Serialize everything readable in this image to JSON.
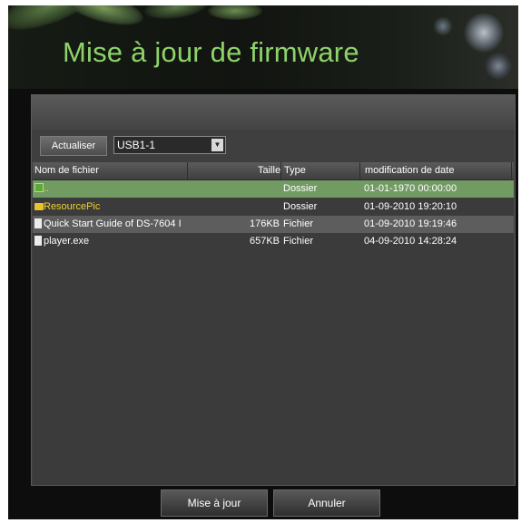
{
  "dialog": {
    "title": "Mise à jour de firmware"
  },
  "toolbar": {
    "refresh_label": "Actualiser",
    "device_select_value": "USB1-1"
  },
  "file_list": {
    "columns": {
      "name": "Nom de fichier",
      "size": "Taille",
      "type": "Type",
      "date": "modification de date"
    },
    "rows": [
      {
        "name": "..",
        "size": "",
        "type": "Dossier",
        "date": "01-01-1970 00:00:00",
        "icon": "parent-folder-icon",
        "selected": true
      },
      {
        "name": "ResourcePic",
        "size": "",
        "type": "Dossier",
        "date": "01-09-2010 19:20:10",
        "icon": "folder-icon"
      },
      {
        "name": "Quick Start Guide of DS-7604 I",
        "size": "176KB",
        "type": "Fichier",
        "date": "01-09-2010 19:19:46",
        "icon": "file-icon"
      },
      {
        "name": "player.exe",
        "size": "657KB",
        "type": "Fichier",
        "date": "04-09-2010 14:28:24",
        "icon": "file-icon"
      }
    ]
  },
  "footer": {
    "update_label": "Mise à jour",
    "cancel_label": "Annuler"
  },
  "colors": {
    "title": "#8ed36a",
    "selected_row": "#719b63",
    "folder_text": "#f2d32c"
  }
}
